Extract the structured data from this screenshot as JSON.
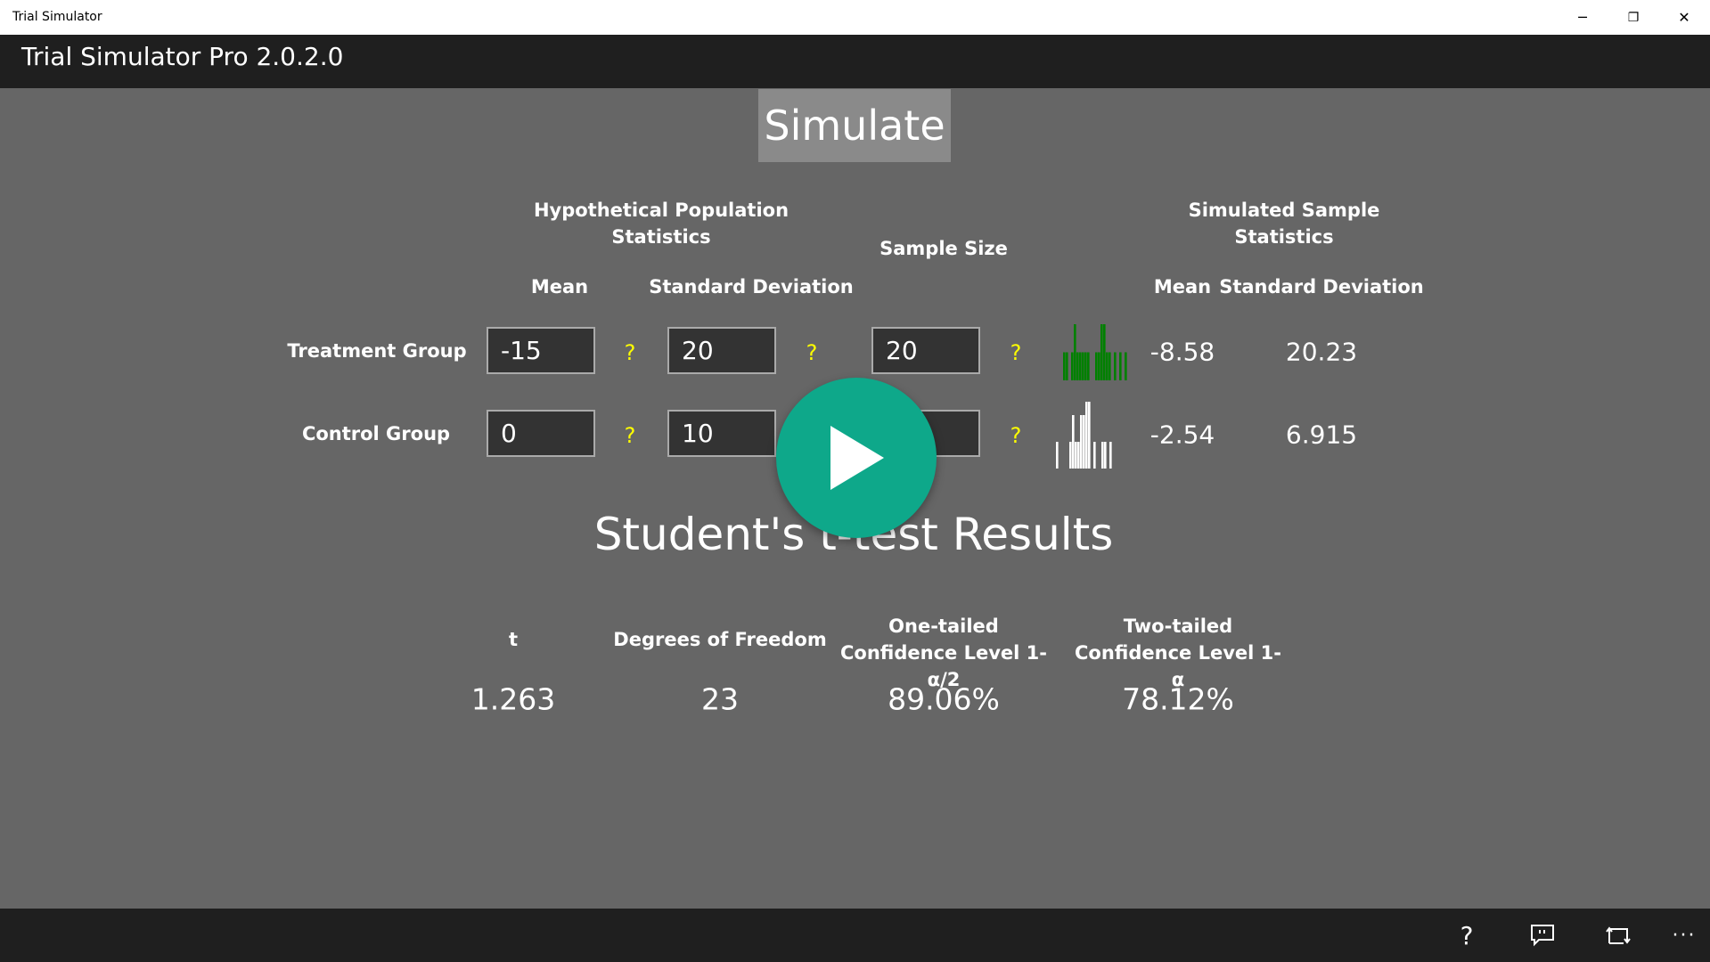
{
  "window": {
    "title": "Trial Simulator",
    "minimize": "─",
    "restore": "❐",
    "close": "✕"
  },
  "app": {
    "title": "Trial Simulator Pro 2.0.2.0"
  },
  "simulate_label": "Simulate",
  "headers": {
    "population": "Hypothetical Population Statistics",
    "sample_size": "Sample Size",
    "simulated": "Simulated Sample Statistics",
    "mean": "Mean",
    "sd": "Standard Deviation",
    "sim_mean": "Mean",
    "sim_sd": "Standard Deviation"
  },
  "help_glyph": "?",
  "groups": [
    {
      "label": "Treatment Group",
      "mean": "-15",
      "sd": "20",
      "n": "20",
      "sim_mean": "-8.58",
      "sim_sd": "20.23",
      "histogram_color": "#008000",
      "histogram": [
        1,
        1,
        0,
        1,
        2,
        1,
        1,
        1,
        1,
        1,
        0,
        0,
        1,
        1,
        2,
        2,
        1,
        1,
        0,
        1,
        0,
        1,
        0,
        1
      ]
    },
    {
      "label": "Control Group",
      "mean": "0",
      "sd": "10",
      "n": "",
      "sim_mean": "-2.54",
      "sim_sd": "6.915",
      "histogram_color": "#ffffff",
      "histogram": [
        2,
        0,
        0,
        0,
        0,
        2,
        4,
        2,
        2,
        4,
        4,
        5,
        5,
        0,
        2,
        0,
        0,
        2,
        2,
        0,
        2
      ]
    }
  ],
  "play_color": "#0ea88a",
  "results": {
    "title": "Student's t-test Results",
    "headers": [
      "t",
      "Degrees of Freedom",
      "One-tailed Confidence Level 1- α/2",
      "Two-tailed Confidence Level 1- α"
    ],
    "values": [
      "1.263",
      "23",
      "89.06%",
      "78.12%"
    ]
  },
  "bottom_icons": [
    "help-icon",
    "feedback-icon",
    "repeat-icon",
    "more-icon"
  ]
}
